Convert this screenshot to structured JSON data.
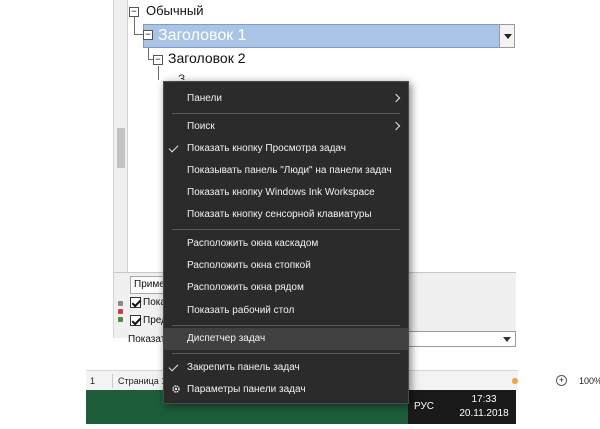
{
  "outline": {
    "normal_label": "Обычный",
    "heading1_label": "Заголовок 1",
    "heading2_label": "Заголовок 2",
    "heading3_partial": "З"
  },
  "pane": {
    "apply_label": "Примени",
    "check1_label": "Показ",
    "check2_label": "Предв",
    "show_label": "Показат"
  },
  "status": {
    "page_cell": "1",
    "page_of": "Страница 1 с",
    "zoom": "100%"
  },
  "context_menu": {
    "items": [
      {
        "label": "Панели",
        "submenu": true,
        "checked": false
      },
      {
        "label": "Поиск",
        "submenu": true,
        "checked": false
      },
      {
        "label": "Показать кнопку Просмотра задач",
        "submenu": false,
        "checked": true
      },
      {
        "label": "Показывать панель \"Люди\" на панели задач",
        "submenu": false,
        "checked": false
      },
      {
        "label": "Показать кнопку Windows Ink Workspace",
        "submenu": false,
        "checked": false
      },
      {
        "label": "Показать кнопку сенсорной клавиатуры",
        "submenu": false,
        "checked": false
      },
      {
        "label": "Расположить окна каскадом",
        "submenu": false,
        "checked": false
      },
      {
        "label": "Расположить окна стопкой",
        "submenu": false,
        "checked": false
      },
      {
        "label": "Расположить окна рядом",
        "submenu": false,
        "checked": false
      },
      {
        "label": "Показать рабочий стол",
        "submenu": false,
        "checked": false
      },
      {
        "label": "Диспетчер задач",
        "submenu": false,
        "checked": false
      },
      {
        "label": "Закрепить панель задач",
        "submenu": false,
        "checked": true
      },
      {
        "label": "Параметры панели задач",
        "submenu": false,
        "checked": false
      }
    ]
  },
  "tray": {
    "language": "РУС",
    "time": "17:33",
    "date": "20.11.2018"
  },
  "colors": {
    "menu_bg": "#2b2b2b",
    "menu_highlight": "#414141",
    "taskbar": "#1d5d3a",
    "heading1_bg": "#aac4e6"
  }
}
